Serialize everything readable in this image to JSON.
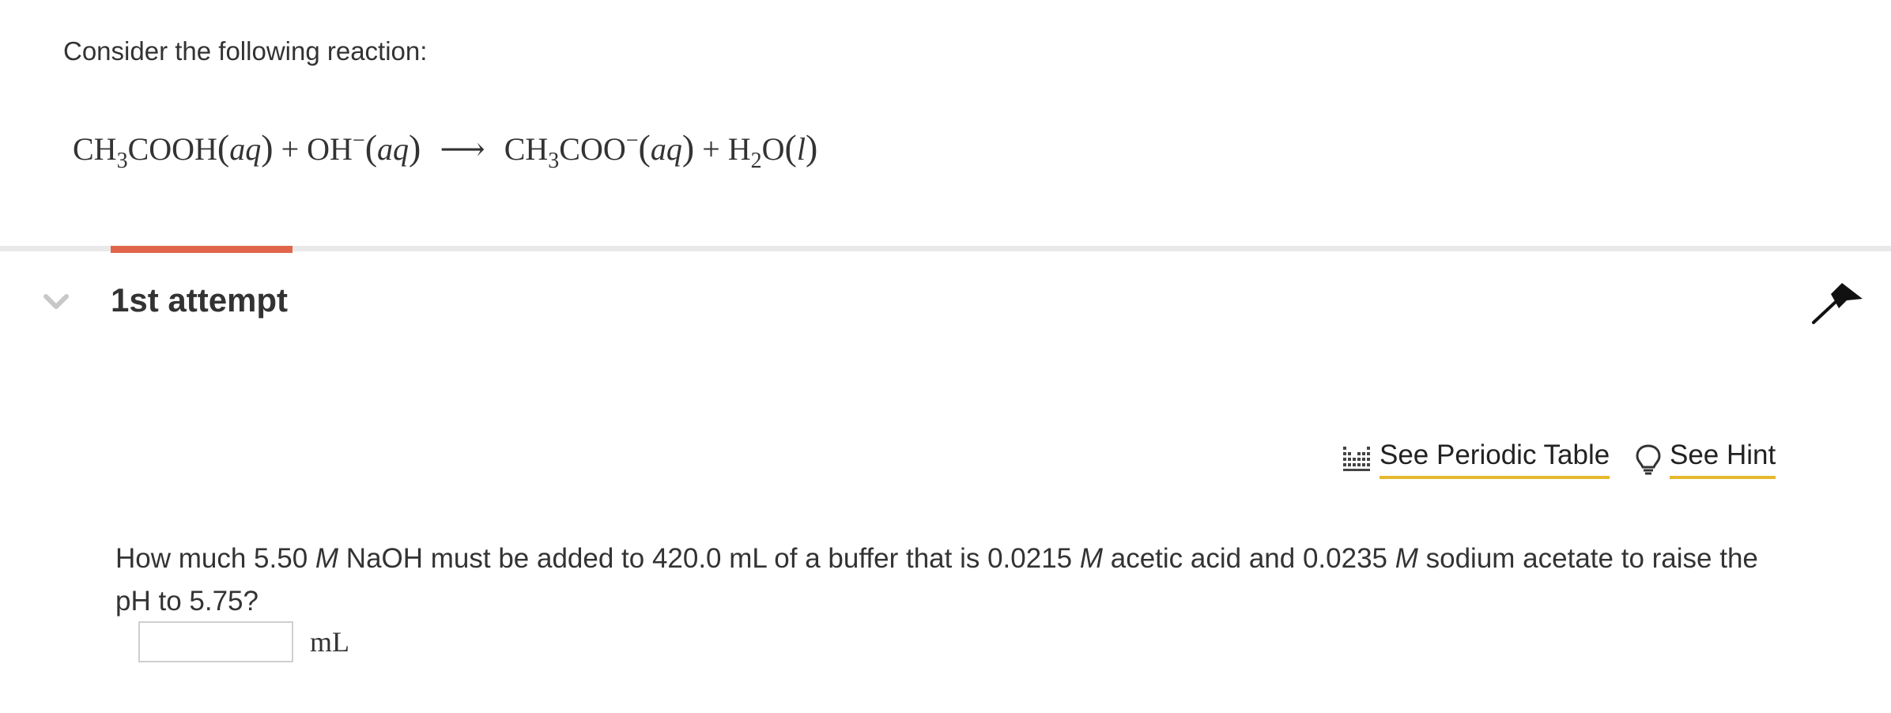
{
  "intro_text": "Consider the following reaction:",
  "reaction": {
    "r1_a": "CH",
    "r1_sub": "3",
    "r1_b": "COOH",
    "r1_state": "aq",
    "plus": "+",
    "r2": "OH",
    "r2_charge": "−",
    "r2_state": "aq",
    "arrow": "⟶",
    "p1_a": "CH",
    "p1_sub": "3",
    "p1_b": "COO",
    "p1_charge": "−",
    "p1_state": "aq",
    "p2_a": "H",
    "p2_sub": "2",
    "p2_b": "O",
    "p2_state": "l"
  },
  "attempt": {
    "title": "1st attempt"
  },
  "tools": {
    "periodic_label": "See Periodic Table",
    "hint_label": "See Hint"
  },
  "question": {
    "p1": "How much 5.50 ",
    "unit1": "M",
    "p2": " NaOH must be added to 420.0 mL of a buffer that is 0.0215 ",
    "unit2": "M",
    "p3": " acetic acid and 0.0235 ",
    "unit3": "M",
    "p4": " sodium acetate to raise the pH to 5.75?"
  },
  "answer": {
    "value": "",
    "unit": "mL"
  },
  "colors": {
    "accent": "#e0664b",
    "link_underline": "#e6b82e",
    "divider": "#e9e9e9"
  }
}
